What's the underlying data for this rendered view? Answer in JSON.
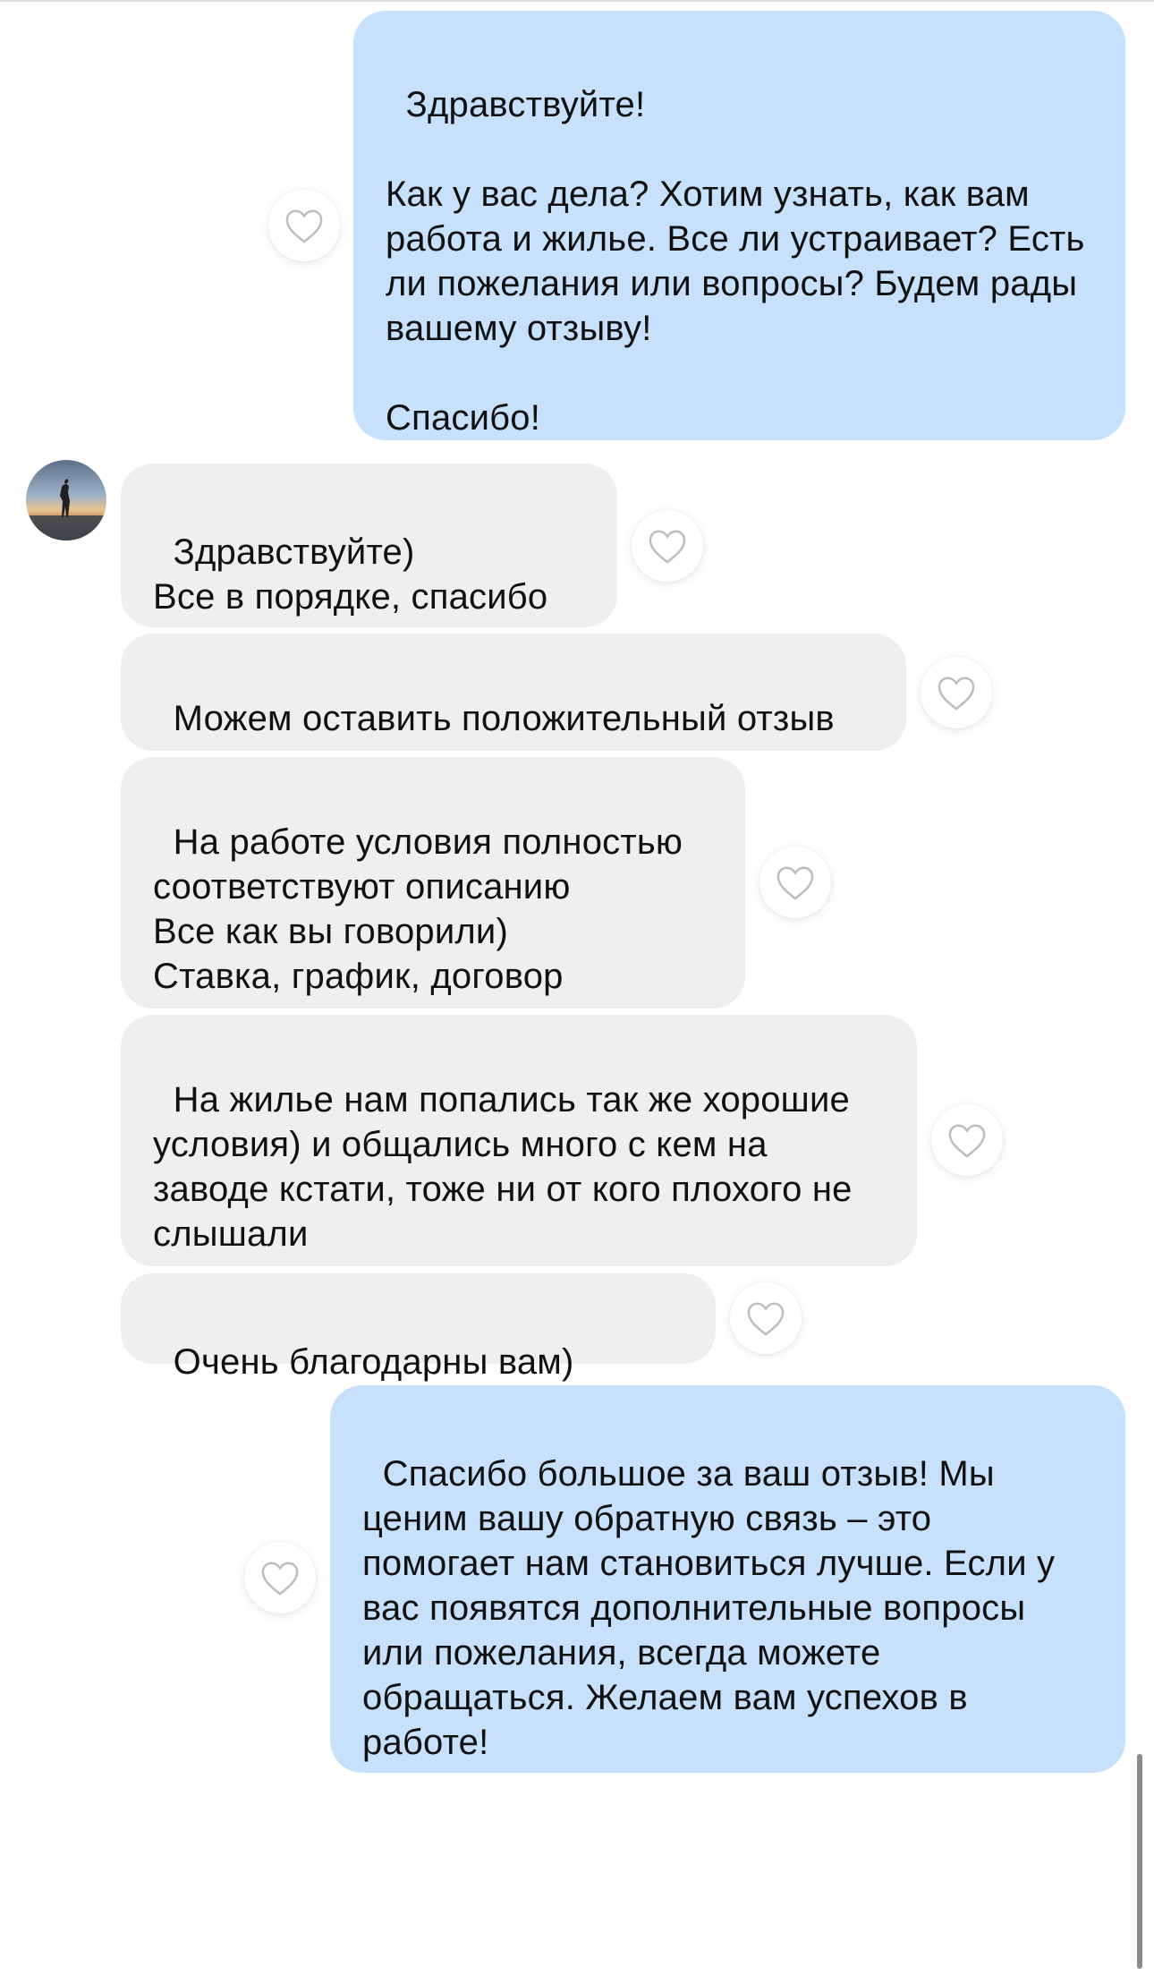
{
  "chat": {
    "messages": [
      {
        "direction": "outgoing",
        "text": "Здравствуйте!\n\nКак у вас дела? Хотим узнать, как вам работа и жилье. Все ли устраивает? Есть ли пожелания или вопросы? Будем рады вашему отзыву!\n\nСпасибо!",
        "liked": false
      },
      {
        "direction": "incoming",
        "text": "Здравствуйте)\nВсе в порядке, спасибо",
        "liked": false
      },
      {
        "direction": "incoming",
        "text": "Можем оставить положительный отзыв",
        "liked": false
      },
      {
        "direction": "incoming",
        "text": "На работе условия полностью соответствуют описанию\nВсе как вы говорили)\nСтавка, график, договор",
        "liked": false
      },
      {
        "direction": "incoming",
        "text": "На жилье нам попались так же хорошие условия) и общались много с кем на заводе кстати, тоже ни от кого плохого не слышали",
        "liked": false
      },
      {
        "direction": "incoming",
        "text": "Очень благодарны вам)",
        "liked": false
      },
      {
        "direction": "outgoing",
        "text": "Спасибо большое за ваш отзыв! Мы ценим вашу обратную связь – это помогает нам становиться лучше. Если у вас появятся дополнительные вопросы или пожелания, всегда можете обращаться. Желаем вам успехов в работе!",
        "liked": false
      }
    ]
  },
  "icons": {
    "like": "heart-outline-icon",
    "avatar": "contact-avatar"
  },
  "colors": {
    "outgoing_bubble": "#c7e0fb",
    "incoming_bubble": "#efefef",
    "heart_stroke": "#bdbdbd"
  }
}
